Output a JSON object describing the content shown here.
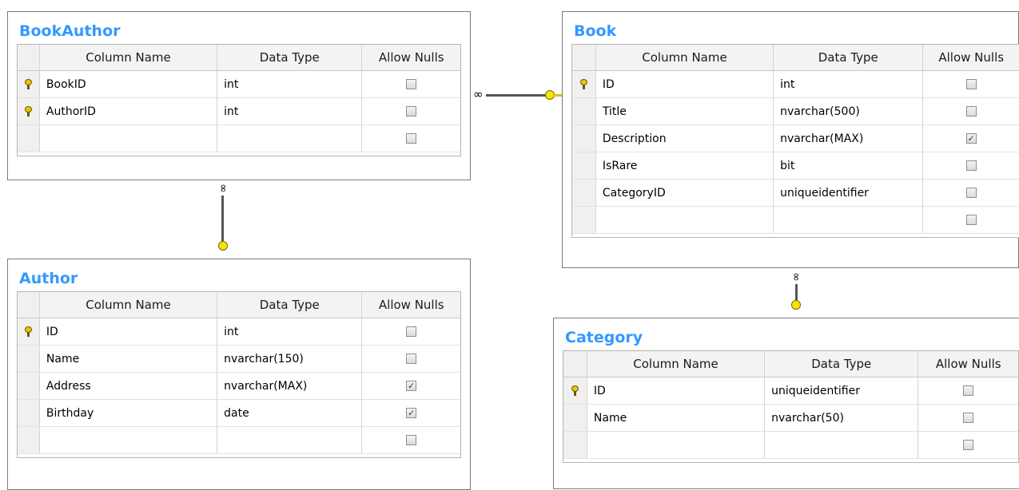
{
  "columns": {
    "name": "Column Name",
    "type": "Data Type",
    "nulls": "Allow Nulls"
  },
  "tables": {
    "bookauthor": {
      "title": "BookAuthor",
      "rows": [
        {
          "name": "BookID",
          "type": "int",
          "pk": true,
          "allow_nulls": false
        },
        {
          "name": "AuthorID",
          "type": "int",
          "pk": true,
          "allow_nulls": false
        },
        {
          "name": "",
          "type": "",
          "pk": false,
          "allow_nulls": false
        }
      ]
    },
    "book": {
      "title": "Book",
      "rows": [
        {
          "name": "ID",
          "type": "int",
          "pk": true,
          "allow_nulls": false
        },
        {
          "name": "Title",
          "type": "nvarchar(500)",
          "pk": false,
          "allow_nulls": false
        },
        {
          "name": "Description",
          "type": "nvarchar(MAX)",
          "pk": false,
          "allow_nulls": true
        },
        {
          "name": "IsRare",
          "type": "bit",
          "pk": false,
          "allow_nulls": false
        },
        {
          "name": "CategoryID",
          "type": "uniqueidentifier",
          "pk": false,
          "allow_nulls": false
        },
        {
          "name": "",
          "type": "",
          "pk": false,
          "allow_nulls": false
        }
      ]
    },
    "author": {
      "title": "Author",
      "rows": [
        {
          "name": "ID",
          "type": "int",
          "pk": true,
          "allow_nulls": false
        },
        {
          "name": "Name",
          "type": "nvarchar(150)",
          "pk": false,
          "allow_nulls": false
        },
        {
          "name": "Address",
          "type": "nvarchar(MAX)",
          "pk": false,
          "allow_nulls": true
        },
        {
          "name": "Birthday",
          "type": "date",
          "pk": false,
          "allow_nulls": true
        },
        {
          "name": "",
          "type": "",
          "pk": false,
          "allow_nulls": false
        }
      ]
    },
    "category": {
      "title": "Category",
      "rows": [
        {
          "name": "ID",
          "type": "uniqueidentifier",
          "pk": true,
          "allow_nulls": false
        },
        {
          "name": "Name",
          "type": "nvarchar(50)",
          "pk": false,
          "allow_nulls": false
        },
        {
          "name": "",
          "type": "",
          "pk": false,
          "allow_nulls": false
        }
      ]
    }
  },
  "relationships": [
    {
      "from": "BookAuthor",
      "to": "Book",
      "many_icon": "infinity-icon",
      "one_icon": "key-icon"
    },
    {
      "from": "BookAuthor",
      "to": "Author",
      "many_icon": "infinity-icon",
      "one_icon": "key-icon"
    },
    {
      "from": "Book",
      "to": "Category",
      "many_icon": "infinity-icon",
      "one_icon": "key-icon"
    }
  ],
  "colors": {
    "title": "#3399ff",
    "key": "#e8c700",
    "check": "#1a3c8c"
  }
}
